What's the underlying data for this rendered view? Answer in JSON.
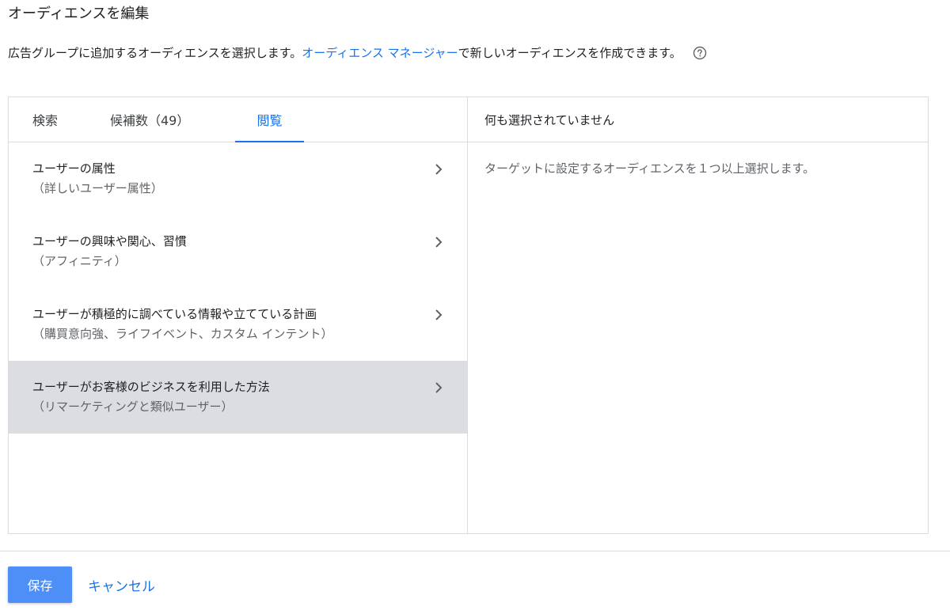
{
  "page": {
    "title": "オーディエンスを編集",
    "description_before": "広告グループに追加するオーディエンスを選択します。",
    "description_link": "オーディエンス マネージャー",
    "description_after": "で新しいオーディエンスを作成できます。",
    "help_icon": "help-circle-icon"
  },
  "tabs": [
    {
      "label": "検索"
    },
    {
      "label": "候補数（49）"
    },
    {
      "label": "閲覧",
      "active": true
    }
  ],
  "categories": [
    {
      "title": "ユーザーの属性",
      "subtitle": "（詳しいユーザー属性）"
    },
    {
      "title": "ユーザーの興味や関心、習慣",
      "subtitle": "（アフィニティ）"
    },
    {
      "title": "ユーザーが積極的に調べている情報や立てている計画",
      "subtitle": "（購買意向強、ライフイベント、カスタム インテント）"
    },
    {
      "title": "ユーザーがお客様のビジネスを利用した方法",
      "subtitle": "（リマーケティングと類似ユーザー）",
      "selected": true
    }
  ],
  "selection_panel": {
    "header": "何も選択されていません",
    "empty_message": "ターゲットに設定するオーディエンスを１つ以上選択します。"
  },
  "footer": {
    "save_label": "保存",
    "cancel_label": "キャンセル"
  },
  "colors": {
    "accent": "#1a73e8",
    "save_button": "#4d8ef7",
    "selected_row": "#dcdde0",
    "border": "#dadce0"
  }
}
